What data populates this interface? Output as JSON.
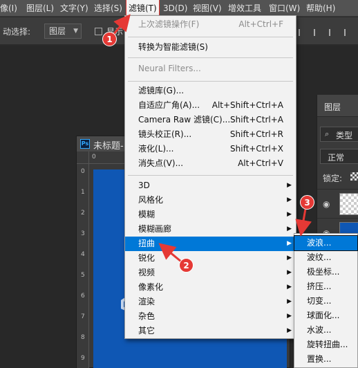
{
  "menubar": {
    "items": [
      {
        "label": "像(I)"
      },
      {
        "label": "图层(L)"
      },
      {
        "label": "文字(Y)"
      },
      {
        "label": "选择(S)"
      },
      {
        "label": "滤镜(T)"
      },
      {
        "label": "3D(D)"
      },
      {
        "label": "视图(V)"
      },
      {
        "label": "增效工具"
      },
      {
        "label": "窗口(W)"
      },
      {
        "label": "帮助(H)"
      }
    ]
  },
  "options_bar": {
    "auto_select_label": "动选择:",
    "layer_dropdown": "图层",
    "show_label": "显示"
  },
  "document": {
    "title": "未标题-",
    "ruler_zero": "0",
    "ruler_left_marks": [
      "0",
      "1",
      "2",
      "3",
      "4",
      "5",
      "6",
      "7",
      "8",
      "9"
    ]
  },
  "layers_panel": {
    "tab": "图层",
    "search_type": "类型",
    "blend_mode": "正常",
    "lock_label": "锁定:"
  },
  "filter_menu": {
    "items": [
      {
        "label": "上次滤镜操作(F)",
        "shortcut": "Alt+Ctrl+F",
        "disabled": true
      },
      {
        "label": "转换为智能滤镜(S)",
        "shortcut": ""
      },
      {
        "label": "Neural Filters...",
        "shortcut": "",
        "disabled": true
      },
      {
        "label": "滤镜库(G)...",
        "shortcut": ""
      },
      {
        "label": "自适应广角(A)...",
        "shortcut": "Alt+Shift+Ctrl+A"
      },
      {
        "label": "Camera Raw 滤镜(C)...",
        "shortcut": "Shift+Ctrl+A"
      },
      {
        "label": "镜头校正(R)...",
        "shortcut": "Shift+Ctrl+R"
      },
      {
        "label": "液化(L)...",
        "shortcut": "Shift+Ctrl+X"
      },
      {
        "label": "消失点(V)...",
        "shortcut": "Alt+Ctrl+V"
      },
      {
        "label": "3D",
        "submenu": true
      },
      {
        "label": "风格化",
        "submenu": true
      },
      {
        "label": "模糊",
        "submenu": true
      },
      {
        "label": "模糊画廊",
        "submenu": true
      },
      {
        "label": "扭曲",
        "submenu": true,
        "highlighted": true
      },
      {
        "label": "锐化",
        "submenu": true
      },
      {
        "label": "视频",
        "submenu": true
      },
      {
        "label": "像素化",
        "submenu": true
      },
      {
        "label": "渲染",
        "submenu": true
      },
      {
        "label": "杂色",
        "submenu": true
      },
      {
        "label": "其它",
        "submenu": true
      }
    ]
  },
  "distort_submenu": {
    "items": [
      {
        "label": "波浪...",
        "highlighted": true
      },
      {
        "label": "波纹..."
      },
      {
        "label": "极坐标..."
      },
      {
        "label": "挤压..."
      },
      {
        "label": "切变..."
      },
      {
        "label": "球面化..."
      },
      {
        "label": "水波..."
      },
      {
        "label": "旋转扭曲..."
      },
      {
        "label": "置换..."
      }
    ]
  },
  "annotations": {
    "badge1": "1",
    "badge2": "2",
    "badge3": "3",
    "color": "#e53935"
  }
}
